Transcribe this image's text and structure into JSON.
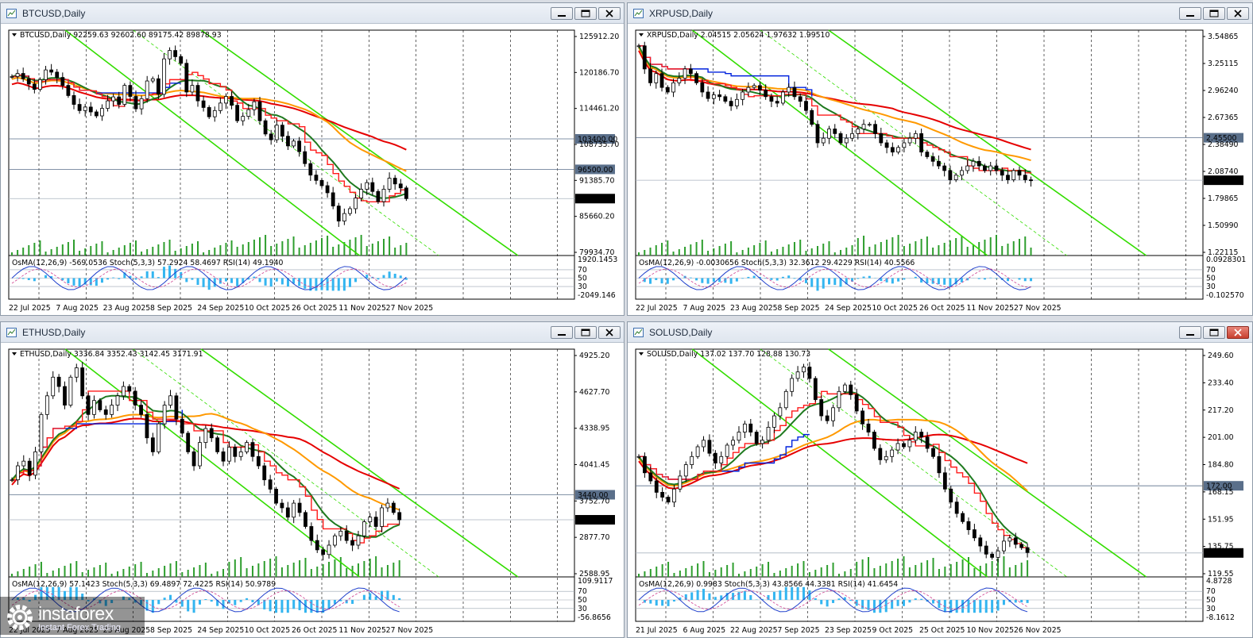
{
  "brand": {
    "name": "instaforex",
    "tagline": "Instant Forex Trading"
  },
  "colors": {
    "ma_dark_green": "#1f7a1f",
    "ma_orange": "#ff9900",
    "ma_red": "#e60000",
    "channel_green": "#33dd00",
    "tenkan_blue": "#0022dd",
    "kijun_red": "#ff1a1a",
    "osma_histogram": "#33b5f0",
    "volume": "#2e9e2e"
  },
  "window_buttons": [
    "minimize",
    "maximize",
    "close"
  ],
  "charts": [
    {
      "id": "btc",
      "title": "BTCUSD,Daily",
      "header": "BTCUSD,Daily  92259.63 92602.60 89175.42 89878.93",
      "indicator_label": "OsMA(12,26,9) -569.0536  Stoch(5,3,3) 57.2924 58.4697  RSI(14) 49.1940",
      "dates": [
        "22 Jul 2025",
        "7 Aug 2025",
        "23 Aug 2025",
        "8 Sep 2025",
        "24 Sep 2025",
        "10 Oct 2025",
        "26 Oct 2025",
        "11 Nov 2025",
        "27 Nov 2025"
      ],
      "price_ticks": [
        "125912.20",
        "120186.70",
        "114461.20",
        "108735.70",
        "103400.00",
        "96500.00",
        "91385.70",
        "89878.93",
        "85660.20",
        "79934.70"
      ],
      "ind_ticks": [
        "1920.1453",
        "70",
        "50",
        "30",
        "-2049.146"
      ],
      "price_marks": [
        {
          "label": "103400.00",
          "value": 103400
        },
        {
          "label": "96500.00",
          "value": 96500
        }
      ],
      "last_price": {
        "label": "89878.93",
        "value": 89878.93
      },
      "chart_data": {
        "type": "line",
        "ylim": [
          77000,
          128000
        ],
        "closes": [
          117500,
          118200,
          117000,
          115800,
          114600,
          116800,
          119000,
          118500,
          117300,
          115500,
          113200,
          111200,
          109800,
          110600,
          109500,
          108600,
          110300,
          112000,
          112900,
          111200,
          115500,
          113000,
          110200,
          112500,
          116500,
          117000,
          113500,
          121500,
          123400,
          122000,
          120500,
          114000,
          115500,
          112000,
          110500,
          108400,
          109800,
          111500,
          113000,
          111000,
          107500,
          108500,
          110000,
          111800,
          107500,
          104500,
          103200,
          106500,
          104000,
          101800,
          102900,
          100500,
          97800,
          95200,
          94000,
          92800,
          91200,
          88200,
          84800,
          86500,
          87600,
          90000,
          92000,
          93500,
          91500,
          89200,
          92000,
          94500,
          93200,
          92300,
          89879
        ]
      }
    },
    {
      "id": "xrp",
      "title": "XRPUSD,Daily",
      "header": "XRPUSD,Daily  2.04515 2.05624 1.97632 1.99510",
      "indicator_label": "OsMA(12,26,9) -0.0030656  Stoch(5,3,3) 32.3612 29.4229  RSI(14) 40.5566",
      "dates": [
        "22 Jul 2025",
        "7 Aug 2025",
        "23 Aug 2025",
        "8 Sep 2025",
        "24 Sep 2025",
        "10 Oct 2025",
        "26 Oct 2025",
        "11 Nov 2025",
        "27 Nov 2025"
      ],
      "price_ticks": [
        "3.54865",
        "3.25115",
        "2.96240",
        "2.67365",
        "2.45500",
        "2.38490",
        "2.08740",
        "1.99510",
        "1.79865",
        "1.50990",
        "1.22115"
      ],
      "ind_ticks": [
        "0.0928301",
        "70",
        "50",
        "30",
        "-0.102570"
      ],
      "price_marks": [
        {
          "label": "2.45500",
          "value": 2.455
        }
      ],
      "last_price": {
        "label": "1.99510",
        "value": 1.9951
      },
      "chart_data": {
        "type": "line",
        "ylim": [
          1.18,
          3.62
        ],
        "closes": [
          3.45,
          3.2,
          3.05,
          3.15,
          3.0,
          2.95,
          3.05,
          3.1,
          3.2,
          3.15,
          3.05,
          2.95,
          2.88,
          2.92,
          2.9,
          2.85,
          2.8,
          2.87,
          2.95,
          3.0,
          3.02,
          2.97,
          2.9,
          2.85,
          2.83,
          2.95,
          3.0,
          2.9,
          2.85,
          2.75,
          2.6,
          2.4,
          2.45,
          2.55,
          2.5,
          2.4,
          2.45,
          2.5,
          2.55,
          2.6,
          2.6,
          2.5,
          2.4,
          2.35,
          2.3,
          2.35,
          2.4,
          2.45,
          2.5,
          2.3,
          2.25,
          2.2,
          2.15,
          2.1,
          2.0,
          2.05,
          2.1,
          2.15,
          2.2,
          2.15,
          2.1,
          2.15,
          2.1,
          2.05,
          2.0,
          2.1,
          2.05,
          2.0,
          1.99
        ]
      }
    },
    {
      "id": "eth",
      "title": "ETHUSD,Daily",
      "header": "ETHUSD,Daily  3336.84 3352.43 3142.45 3171.91",
      "indicator_label": "OsMA(12,26,9) 57.1423  Stoch(5,3,3) 69.4897 72.4225  RSI(14) 50.9789",
      "dates": [
        "22 Jul 2025",
        "7 Aug 2025",
        "23 Aug 2025",
        "8 Sep 2025",
        "24 Sep 2025",
        "10 Oct 2025",
        "26 Oct 2025",
        "11 Nov 2025",
        "27 Nov 2025"
      ],
      "price_ticks": [
        "4925.20",
        "4627.70",
        "4338.95",
        "4041.45",
        "3752.70",
        "3440.00",
        "3171.91",
        "2877.70",
        "2588.95"
      ],
      "ind_ticks": [
        "109.9117",
        "70",
        "50",
        "30",
        "-56.8656"
      ],
      "price_marks": [
        {
          "label": "3440.00",
          "value": 3440
        }
      ],
      "last_price": {
        "label": "3171.91",
        "value": 3171.91
      },
      "chart_data": {
        "type": "line",
        "ylim": [
          2560,
          5000
        ],
        "closes": [
          3600,
          3750,
          3800,
          3650,
          3900,
          4300,
          4500,
          4700,
          4600,
          4400,
          4700,
          4800,
          4500,
          4300,
          4450,
          4350,
          4300,
          4400,
          4500,
          4600,
          4550,
          4400,
          4300,
          4050,
          3900,
          4200,
          4400,
          4500,
          4250,
          4100,
          3900,
          3750,
          4000,
          4150,
          4050,
          3900,
          3800,
          3950,
          3850,
          3900,
          4000,
          3850,
          3750,
          3600,
          3500,
          3350,
          3300,
          3200,
          3350,
          3250,
          3100,
          2950,
          2850,
          2800,
          2900,
          3000,
          3050,
          2950,
          2900,
          3000,
          3150,
          3200,
          3100,
          3300,
          3350,
          3250,
          3172
        ]
      }
    },
    {
      "id": "sol",
      "title": "SOLUSD,Daily",
      "header": "SOLUSD,Daily  137.02 137.70 128.88 130.73",
      "indicator_label": "OsMA(12,26,9) 0.9983  Stoch(5,3,3) 43.8566 44.3381  RSI(14) 41.6454",
      "dates": [
        "21 Jul 2025",
        "6 Aug 2025",
        "22 Aug 2025",
        "7 Sep 2025",
        "23 Sep 2025",
        "9 Oct 2025",
        "25 Oct 2025",
        "10 Nov 2025",
        "26 Nov 2025"
      ],
      "price_ticks": [
        "249.60",
        "233.40",
        "217.20",
        "201.00",
        "184.80",
        "172.00",
        "168.15",
        "151.95",
        "135.75",
        "130.73",
        "119.55"
      ],
      "ind_ticks": [
        "4.8728",
        "70",
        "50",
        "30",
        "-8.1612"
      ],
      "price_marks": [
        {
          "label": "172.00",
          "value": 172
        }
      ],
      "last_price": {
        "label": "130.73",
        "value": 130.73
      },
      "chart_data": {
        "type": "line",
        "ylim": [
          116,
          256
        ],
        "closes": [
          190,
          180,
          175,
          168,
          165,
          162,
          170,
          178,
          185,
          190,
          196,
          200,
          192,
          186,
          190,
          197,
          200,
          205,
          210,
          205,
          198,
          200,
          208,
          215,
          220,
          230,
          238,
          242,
          245,
          238,
          225,
          215,
          212,
          220,
          230,
          234,
          228,
          218,
          210,
          205,
          195,
          188,
          190,
          194,
          198,
          196,
          200,
          205,
          202,
          195,
          190,
          180,
          170,
          162,
          155,
          150,
          145,
          140,
          135,
          130,
          128,
          132,
          138,
          140,
          136,
          134,
          131
        ]
      }
    }
  ]
}
